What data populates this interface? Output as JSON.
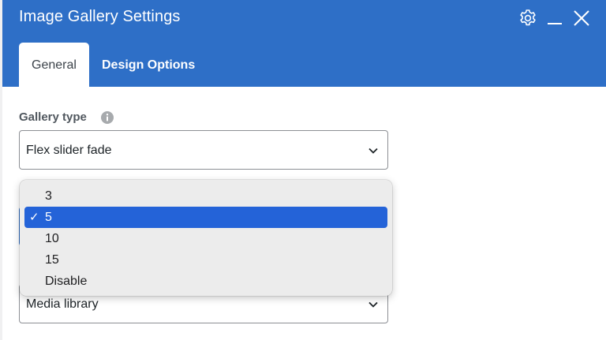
{
  "header": {
    "title": "Image Gallery Settings",
    "icons": [
      "gear-icon",
      "minimize-icon",
      "close-icon"
    ],
    "background": "#2e6fc7"
  },
  "tabs": [
    {
      "label": "General",
      "active": true
    },
    {
      "label": "Design Options",
      "active": false
    }
  ],
  "gallery_type": {
    "label": "Gallery type",
    "value": "Flex slider fade"
  },
  "dropdown": {
    "options": [
      "3",
      "5",
      "10",
      "15",
      "Disable"
    ],
    "selected": "5",
    "check_mark": "✓",
    "highlight_color": "#2463d8"
  },
  "image_source": {
    "value": "Media library"
  }
}
